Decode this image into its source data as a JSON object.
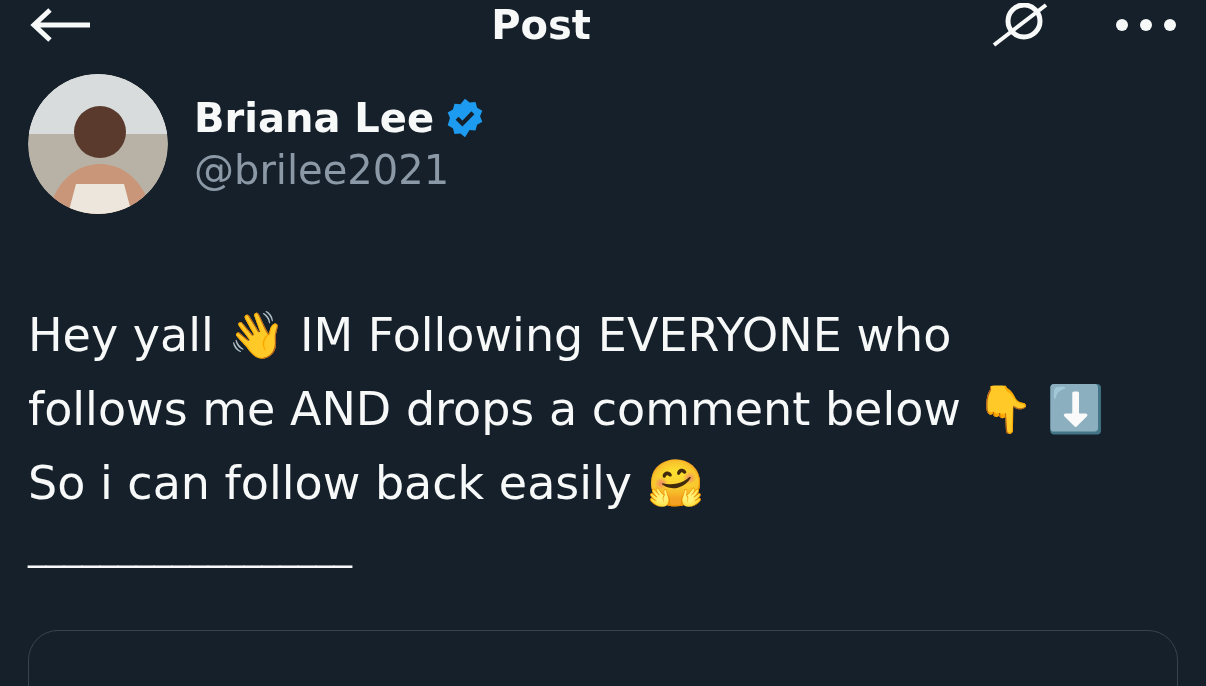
{
  "header": {
    "title": "Post"
  },
  "author": {
    "name": "Briana Lee",
    "verified": true,
    "handle": "@brilee2021"
  },
  "body": {
    "lines": [
      "Hey yall 👋 IM Following EVERYONE who",
      "follows me AND drops a comment below  👇 ⬇️",
      "So i can follow back easily 🤗"
    ]
  },
  "separator": "__________________"
}
